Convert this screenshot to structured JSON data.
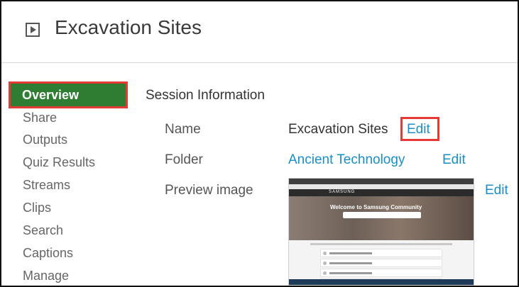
{
  "header": {
    "title": "Excavation Sites",
    "icon": "play-box-icon"
  },
  "sidebar": {
    "items": [
      {
        "label": "Overview",
        "active": true
      },
      {
        "label": "Share"
      },
      {
        "label": "Outputs"
      },
      {
        "label": "Quiz Results"
      },
      {
        "label": "Streams"
      },
      {
        "label": "Clips"
      },
      {
        "label": "Search"
      },
      {
        "label": "Captions"
      },
      {
        "label": "Manage"
      }
    ]
  },
  "session": {
    "title": "Session Information",
    "name_label": "Name",
    "name_value": "Excavation Sites",
    "folder_label": "Folder",
    "folder_value": "Ancient Technology",
    "preview_label": "Preview image",
    "edit_label": "Edit"
  },
  "preview_thumb": {
    "logo": "SAMSUNG",
    "hero_text": "Welcome to Samsung Community"
  },
  "colors": {
    "active_bg": "#2e7d32",
    "highlight_border": "#e53935",
    "link": "#1a8fc7"
  }
}
